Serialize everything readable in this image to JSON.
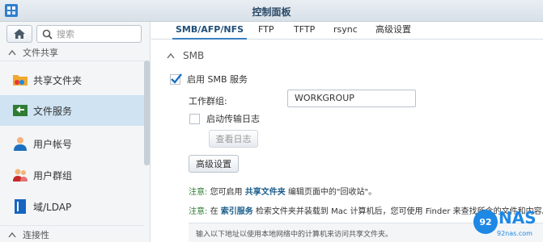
{
  "window": {
    "title": "控制面板"
  },
  "sidebar": {
    "search_placeholder": "搜索",
    "section_top": "文件共享",
    "section_bottom": "连接性",
    "items": [
      {
        "label": "共享文件夹",
        "icon": "shared-folder-icon"
      },
      {
        "label": "文件服务",
        "icon": "file-services-icon",
        "active": true
      },
      {
        "label": "用户帐号",
        "icon": "user-icon"
      },
      {
        "label": "用户群组",
        "icon": "group-icon"
      },
      {
        "label": "域/LDAP",
        "icon": "domain-ldap-icon"
      }
    ]
  },
  "tabs": [
    {
      "label": "SMB/AFP/NFS",
      "active": true
    },
    {
      "label": "FTP"
    },
    {
      "label": "TFTP"
    },
    {
      "label": "rsync"
    },
    {
      "label": "高级设置"
    }
  ],
  "smb": {
    "section_title": "SMB",
    "enable_label": "启用 SMB 服务",
    "enable_checked": true,
    "workgroup_label": "工作群组:",
    "workgroup_value": "WORKGROUP",
    "transfer_log_label": "启动传输日志",
    "transfer_log_checked": false,
    "view_log_button": "查看日志",
    "advanced_button": "高级设置"
  },
  "notes": {
    "note1_prefix": "注意:",
    "note1_a": "您可启用",
    "note1_link": "共享文件夹",
    "note1_b": "编辑页面中的\"回收站\"。",
    "note2_prefix": "注意:",
    "note2_a": "在",
    "note2_link": "索引服务",
    "note2_b": "检索文件夹并装载到 Mac 计算机后，您可使用 Finder 来查找所含的文件和内容。",
    "info_text": "输入以下地址以使用本地网络中的计算机来访问共享文件夹。"
  },
  "watermark": {
    "badge": "92",
    "brand": "NAS",
    "url": "92nas.com"
  },
  "colors": {
    "accent": "#3a7fc1",
    "active_bg": "#cfe3f2",
    "note_green": "#2e7d32",
    "link_blue": "#1b5e8a"
  }
}
